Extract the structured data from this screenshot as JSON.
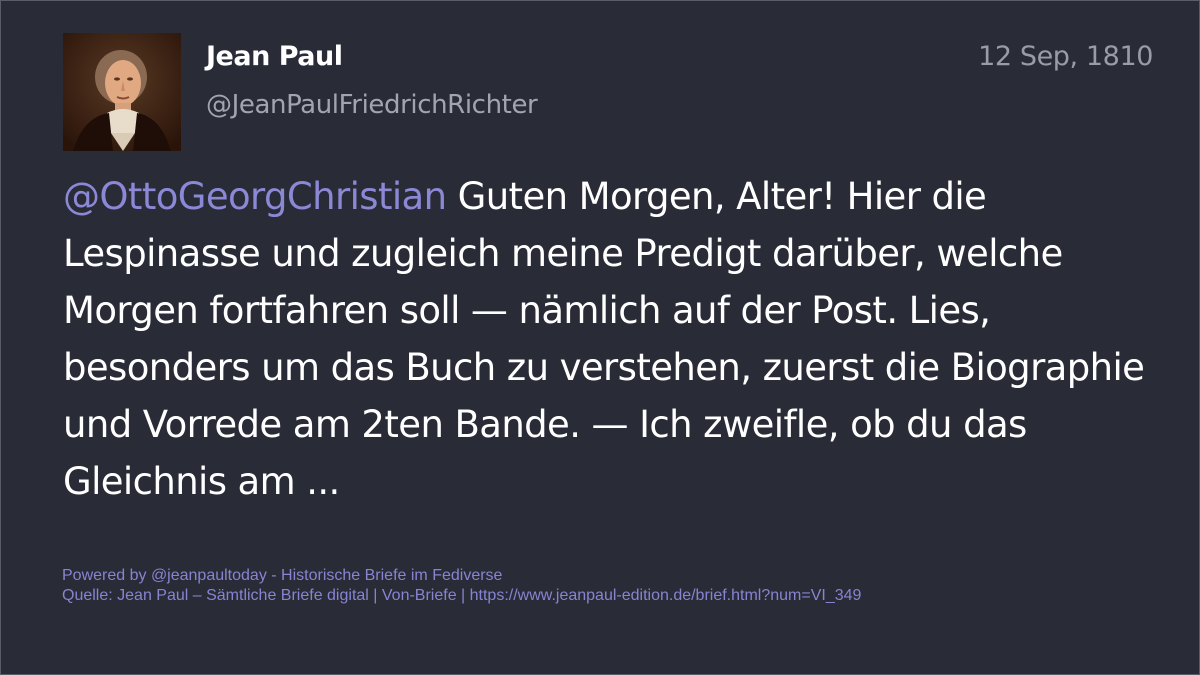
{
  "post": {
    "author_name": "Jean Paul",
    "author_handle": "@JeanPaulFriedrichRichter",
    "date": "12 Sep, 1810",
    "mention": "@OttoGeorgChristian",
    "text": " Guten Morgen, Alter! Hier die Lespinasse und zugleich meine Predigt darüber, welche Morgen fortfahren soll — nämlich auf der Post. Lies, besonders um das Buch zu verstehen, zuerst die Biographie und Vorrede am 2ten Bande. — Ich zweifle, ob du das Gleichnis am ...",
    "avatar_icon": "portrait-avatar"
  },
  "footer": {
    "powered_by": "Powered by @jeanpaultoday - Historische Briefe im Fediverse",
    "source": "Quelle: Jean Paul – Sämtliche Briefe digital | Von-Briefe | https://www.jeanpaul-edition.de/brief.html?num=VI_349"
  },
  "colors": {
    "background": "#292b36",
    "mention": "#8b88d6",
    "footer": "#8784d2",
    "text": "#ffffff",
    "muted": "#a3a5ae"
  }
}
